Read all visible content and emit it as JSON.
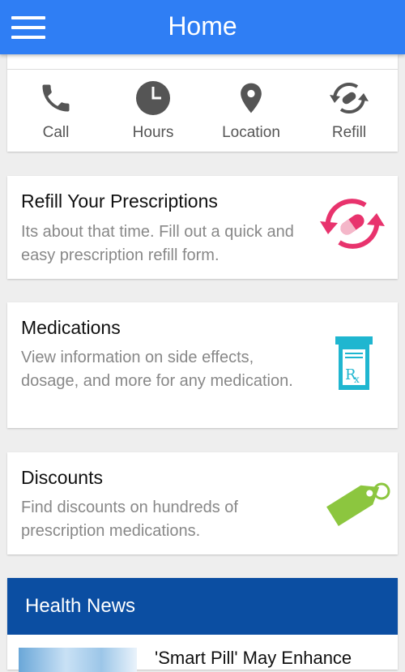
{
  "header": {
    "title": "Home"
  },
  "quick_actions": [
    {
      "label": "Call",
      "icon": "phone-icon"
    },
    {
      "label": "Hours",
      "icon": "clock-icon"
    },
    {
      "label": "Location",
      "icon": "location-pin-icon"
    },
    {
      "label": "Refill",
      "icon": "refill-icon"
    }
  ],
  "cards": [
    {
      "title": "Refill Your Prescriptions",
      "description": "Its about that time. Fill out a quick and easy prescription refill form.",
      "icon": "refill-pill-icon",
      "color": "#e8336d"
    },
    {
      "title": "Medications",
      "description": "View information on side effects, dosage, and more for any medication.",
      "icon": "prescription-bottle-icon",
      "color": "#1fb6d0"
    },
    {
      "title": "Discounts",
      "description": "Find discounts on hundreds of prescription medications.",
      "icon": "discount-tag-icon",
      "color": "#8cc63f"
    }
  ],
  "news": {
    "heading": "Health News",
    "headline": "'Smart Pill' May Enhance"
  },
  "colors": {
    "appbar": "#2f7ef4",
    "news_header": "#0b4ea2",
    "icon_gray": "#555555"
  }
}
